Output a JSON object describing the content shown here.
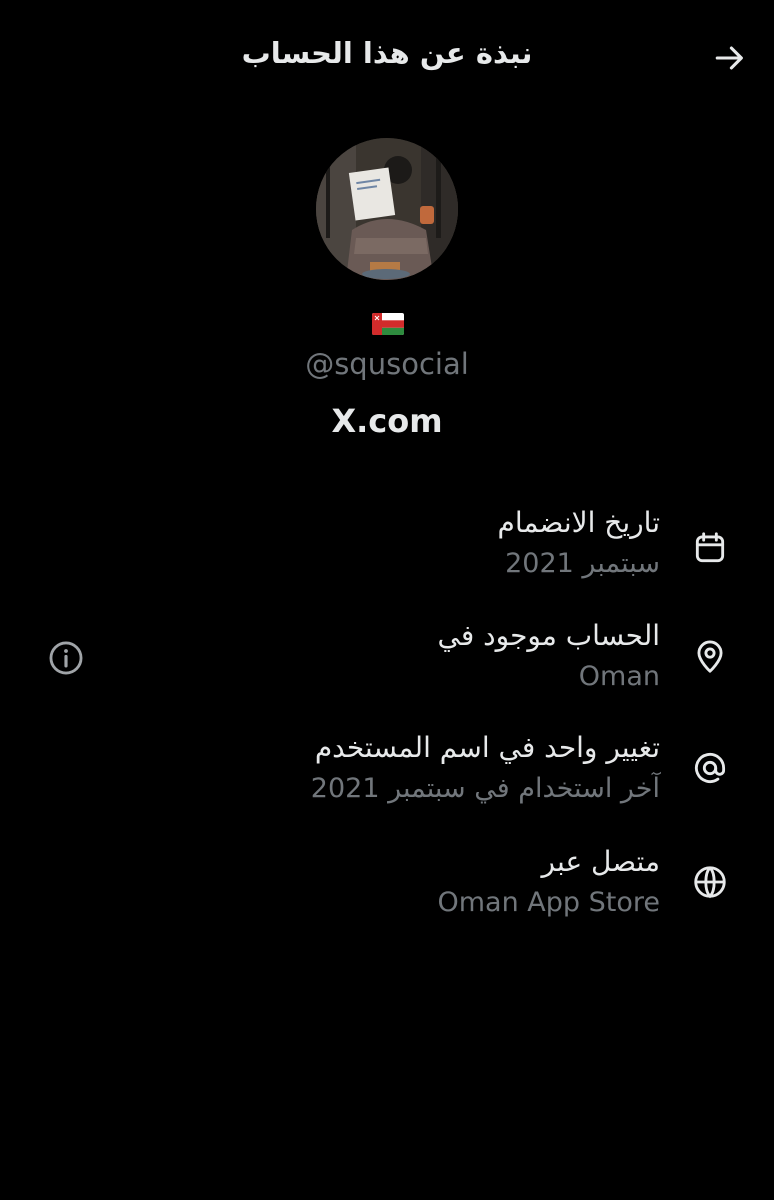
{
  "header": {
    "title": "نبذة عن هذا الحساب",
    "back_icon": "arrow-right-icon"
  },
  "profile": {
    "flag_icon": "oman-flag-icon",
    "handle": "@squsocial",
    "site": "X.com"
  },
  "details": [
    {
      "icon": "calendar-icon",
      "title": "تاريخ الانضمام",
      "value": "سبتمبر 2021"
    },
    {
      "icon": "location-pin-icon",
      "title": "الحساب موجود في",
      "value": "Oman"
    },
    {
      "icon": "at-sign-icon",
      "title": "تغيير واحد في اسم المستخدم",
      "value": "آخر استخدام في سبتمبر 2021"
    },
    {
      "icon": "globe-icon",
      "title": "متصل عبر",
      "value": "Oman App Store"
    }
  ],
  "colors": {
    "background": "#000000",
    "primary_text": "#e7e9ea",
    "secondary_text": "#71767b"
  }
}
